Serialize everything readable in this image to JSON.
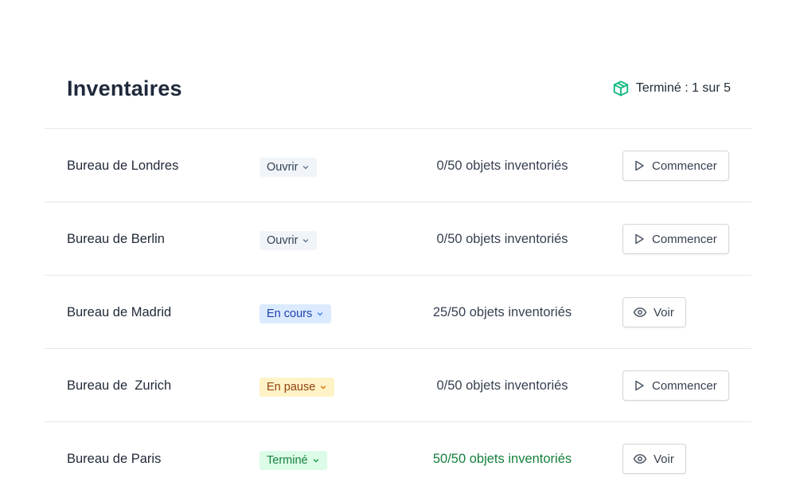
{
  "header": {
    "title": "Inventaires",
    "summary": "Terminé : 1 sur 5",
    "summary_icon": "box-icon",
    "accent_color": "#10b981"
  },
  "rows": [
    {
      "name": "Bureau de Londres",
      "status": "Ouvrir",
      "status_kind": "open",
      "count": "0/50 objets inventoriés",
      "action": "Commencer",
      "action_icon": "play-icon"
    },
    {
      "name": "Bureau de Berlin",
      "status": "Ouvrir",
      "status_kind": "open",
      "count": "0/50 objets inventoriés",
      "action": "Commencer",
      "action_icon": "play-icon"
    },
    {
      "name": "Bureau de Madrid",
      "status": "En cours",
      "status_kind": "progress",
      "count": "25/50 objets inventoriés",
      "action": "Voir",
      "action_icon": "eye-icon"
    },
    {
      "name": "Bureau de  Zurich",
      "status": "En pause",
      "status_kind": "paused",
      "count": "0/50 objets inventoriés",
      "action": "Commencer",
      "action_icon": "play-icon"
    },
    {
      "name": "Bureau de Paris",
      "status": "Terminé",
      "status_kind": "done",
      "count": "50/50 objets inventoriés",
      "action": "Voir",
      "action_icon": "eye-icon"
    }
  ]
}
